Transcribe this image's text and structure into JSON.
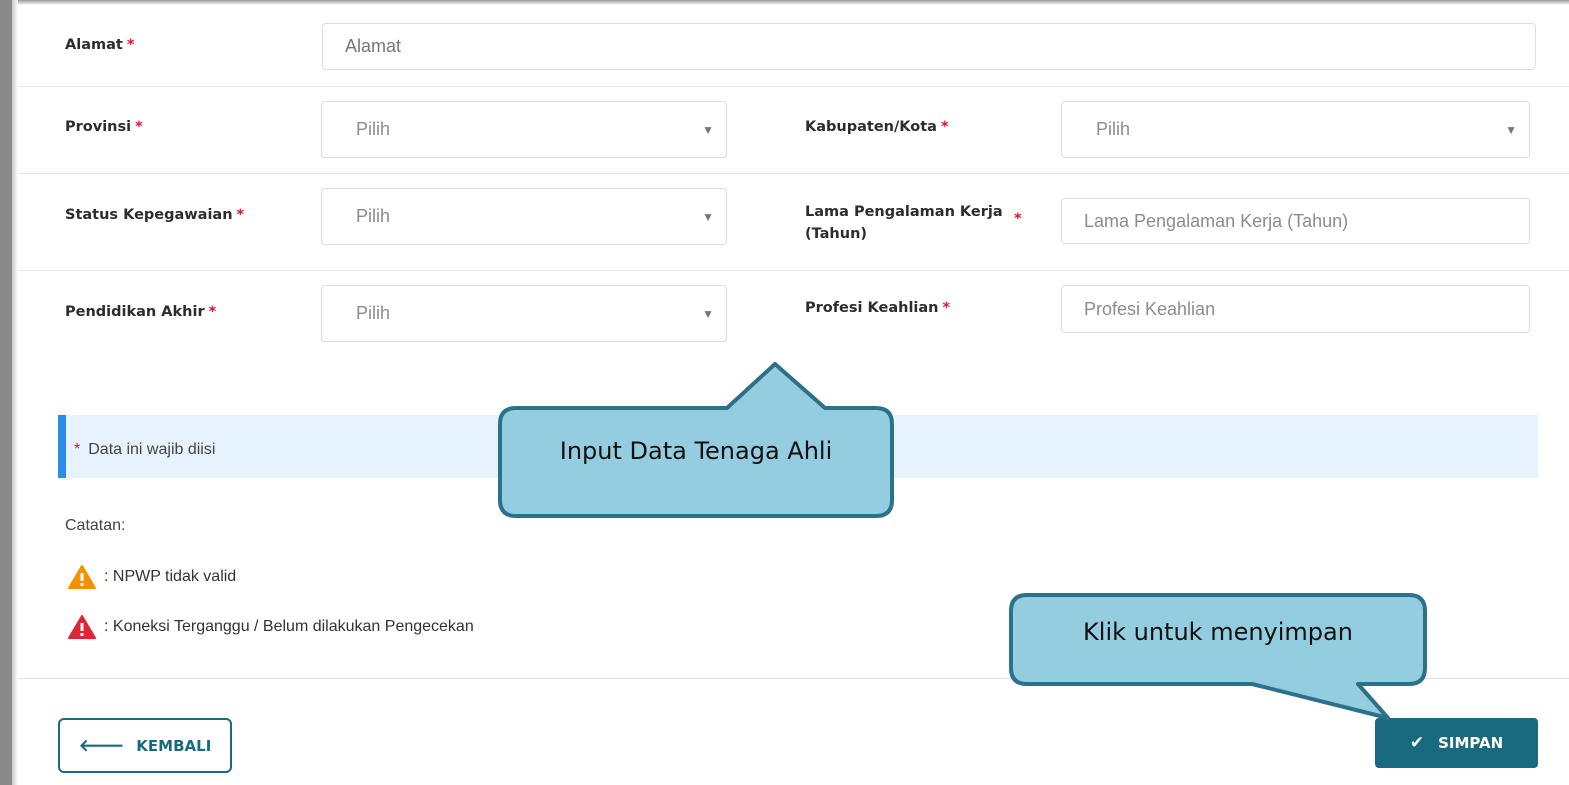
{
  "form": {
    "alamat": {
      "label": "Alamat",
      "required": "*",
      "placeholder": "Alamat"
    },
    "provinsi": {
      "label": "Provinsi",
      "required": "*",
      "value": "Pilih"
    },
    "kabupaten": {
      "label": "Kabupaten/Kota",
      "required": "*",
      "value": "Pilih"
    },
    "status": {
      "label": "Status Kepegawaian",
      "required": "*",
      "value": "Pilih"
    },
    "pengalaman": {
      "label_line1": "Lama Pengalaman Kerja",
      "label_line2": "(Tahun)",
      "required": "*",
      "placeholder": "Lama Pengalaman Kerja (Tahun)"
    },
    "pendidikan": {
      "label": "Pendidikan Akhir",
      "required": "*",
      "value": "Pilih"
    },
    "profesi": {
      "label": "Profesi Keahlian",
      "required": "*",
      "placeholder": "Profesi Keahlian"
    }
  },
  "info": {
    "required_mark": "*",
    "text": "Data ini wajib diisi"
  },
  "notes": {
    "title": "Catatan:",
    "items": [
      {
        "icon": "warning-orange-icon",
        "text": ": NPWP tidak valid",
        "color": "#f39200"
      },
      {
        "icon": "warning-red-icon",
        "text": ": Koneksi Terganggu / Belum dilakukan Pengecekan",
        "color": "#e02438"
      }
    ]
  },
  "buttons": {
    "back": {
      "icon": "arrow-left-icon",
      "label": "KEMBALI"
    },
    "save": {
      "icon": "check-icon",
      "label": "SIMPAN"
    }
  },
  "callouts": {
    "input": "Input Data Tenaga Ahli",
    "save": "Klik untuk menyimpan"
  },
  "colors": {
    "primary": "#19697f",
    "required": "#e4122a",
    "info_bg": "#e6f2fd",
    "info_border": "#2b8be8",
    "callout_fill": "#95cde0",
    "callout_border": "#2b7189"
  }
}
